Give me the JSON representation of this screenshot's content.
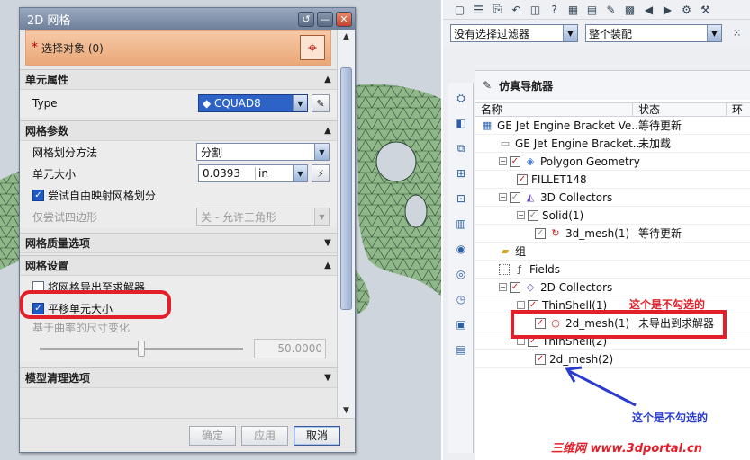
{
  "dialog": {
    "title": "2D 网格",
    "title_buttons": [
      "↺",
      "—",
      "✕"
    ],
    "select_object": {
      "star": "*",
      "label": "选择对象 (0)"
    },
    "groups": {
      "element_props": {
        "header": "单元属性",
        "type_label": "Type",
        "type_value": "CQUAD8"
      },
      "mesh_params": {
        "header": "网格参数",
        "method_label": "网格划分方法",
        "method_value": "分割",
        "size_label": "单元大小",
        "size_value": "0.0393",
        "size_unit": "in",
        "free_map_label": "尝试自由映射网格划分",
        "free_map_checked": true,
        "quad_only_label": "仅尝试四边形",
        "quad_only_value": "关 - 允许三角形"
      },
      "quality": {
        "header": "网格质量选项"
      },
      "settings": {
        "header": "网格设置",
        "export_label": "将网格导出至求解器",
        "export_checked": false,
        "smooth_label": "平移单元大小",
        "smooth_checked": true,
        "curvature_label": "基于曲率的尺寸变化",
        "curvature_value": "50.0000",
        "curvature_fraction": 0.5
      },
      "cleanup": {
        "header": "模型清理选项"
      }
    },
    "buttons": {
      "ok": "确定",
      "apply": "应用",
      "cancel": "取消"
    }
  },
  "right": {
    "filter_combo": "没有选择过滤器",
    "assembly_combo": "整个装配",
    "navigator_title": "仿真导航器",
    "columns": [
      "名称",
      "状态",
      "环"
    ],
    "tree": [
      {
        "name": "GE Jet Engine Bracket Ve...",
        "status": "等待更新",
        "indent": 0,
        "icon": "sim-icon",
        "check": "none",
        "expander": ""
      },
      {
        "name": "GE Jet Engine Bracket...",
        "status": "未加载",
        "indent": 1,
        "icon": "part-icon",
        "check": "none",
        "expander": ""
      },
      {
        "name": "Polygon Geometry",
        "status": "",
        "indent": 1,
        "icon": "cube-icon",
        "check": "red",
        "expander": "−"
      },
      {
        "name": "FILLET148",
        "status": "",
        "indent": 2,
        "icon": "",
        "check": "red",
        "expander": ""
      },
      {
        "name": "3D Collectors",
        "status": "",
        "indent": 1,
        "icon": "collector-3d-icon",
        "check": "grey",
        "expander": "−"
      },
      {
        "name": "Solid(1)",
        "status": "",
        "indent": 2,
        "icon": "",
        "check": "grey",
        "expander": "−"
      },
      {
        "name": "3d_mesh(1)",
        "status": "等待更新",
        "indent": 3,
        "icon": "mesh-3d-icon",
        "check": "grey",
        "expander": ""
      },
      {
        "name": "组",
        "status": "",
        "indent": 1,
        "icon": "folder-icon",
        "check": "none",
        "expander": ""
      },
      {
        "name": "Fields",
        "status": "",
        "indent": 1,
        "icon": "fields-icon",
        "check": "empty",
        "expander": ""
      },
      {
        "name": "2D Collectors",
        "status": "",
        "indent": 1,
        "icon": "collector-2d-icon",
        "check": "red",
        "expander": "−"
      },
      {
        "name": "ThinShell(1)",
        "status": "",
        "indent": 2,
        "icon": "",
        "check": "red",
        "expander": "−"
      },
      {
        "name": "2d_mesh(1)",
        "status": "未导出到求解器",
        "indent": 3,
        "icon": "mesh-2d-icon",
        "check": "red",
        "expander": ""
      },
      {
        "name": "ThinShell(2)",
        "status": "",
        "indent": 2,
        "icon": "",
        "check": "red",
        "expander": "−"
      },
      {
        "name": "2d_mesh(2)",
        "status": "",
        "indent": 3,
        "icon": "",
        "check": "red",
        "expander": ""
      }
    ]
  },
  "annotations": {
    "unchecked_top": "这个是不勾选的",
    "unchecked_bottom": "这个是不勾选的",
    "watermark": "三维网 www.3dportal.cn"
  },
  "colors": {
    "highlight_red": "#e2202a",
    "arrow_blue": "#2a3ccd",
    "accent_orange": "#eaa877"
  }
}
